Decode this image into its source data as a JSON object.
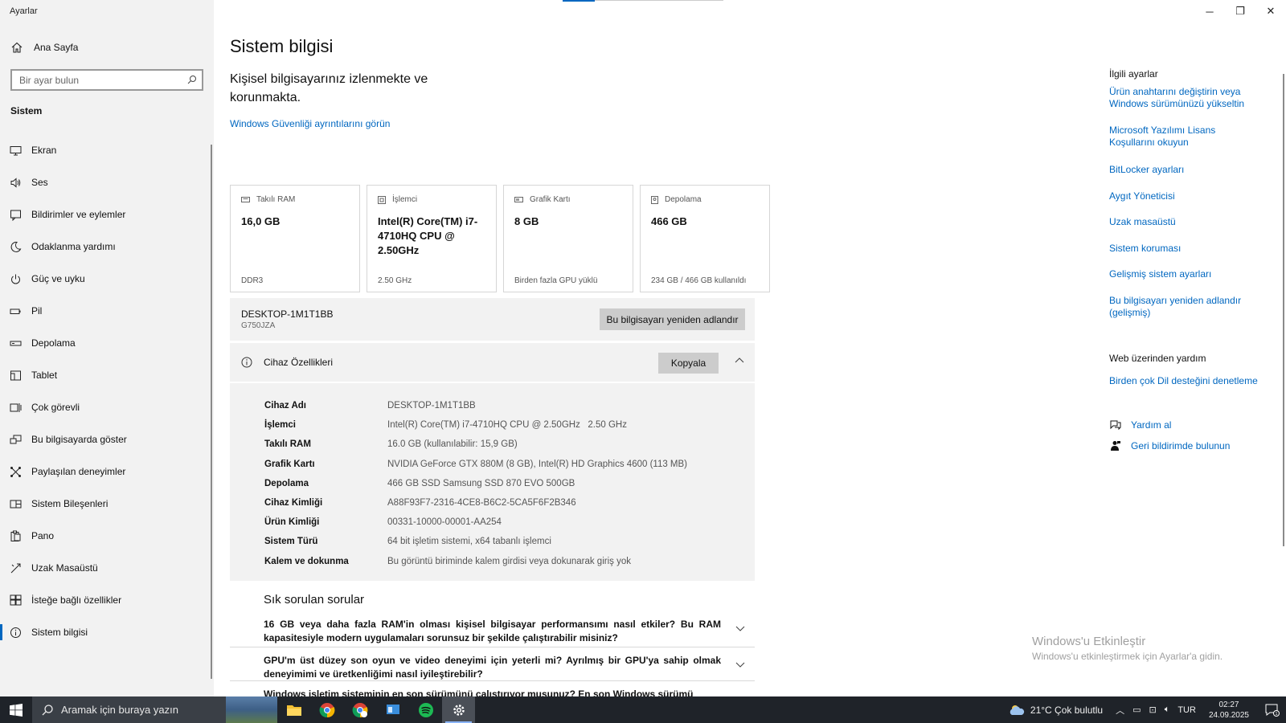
{
  "app": {
    "title": "Ayarlar"
  },
  "window": {
    "minimize": "─",
    "restore": "❐",
    "close": "✕"
  },
  "sidebar": {
    "home_label": "Ana Sayfa",
    "search_placeholder": "Bir ayar bulun",
    "section": "Sistem",
    "items": [
      {
        "label": "Ekran",
        "icon": "monitor-icon"
      },
      {
        "label": "Ses",
        "icon": "speaker-icon"
      },
      {
        "label": "Bildirimler ve eylemler",
        "icon": "notification-icon"
      },
      {
        "label": "Odaklanma yardımı",
        "icon": "moon-icon"
      },
      {
        "label": "Güç ve uyku",
        "icon": "power-icon"
      },
      {
        "label": "Pil",
        "icon": "battery-icon"
      },
      {
        "label": "Depolama",
        "icon": "storage-icon"
      },
      {
        "label": "Tablet",
        "icon": "tablet-icon"
      },
      {
        "label": "Çok görevli",
        "icon": "multitask-icon"
      },
      {
        "label": "Bu bilgisayarda göster",
        "icon": "project-icon"
      },
      {
        "label": "Paylaşılan deneyimler",
        "icon": "share-icon"
      },
      {
        "label": "Sistem Bileşenleri",
        "icon": "components-icon"
      },
      {
        "label": "Pano",
        "icon": "clipboard-icon"
      },
      {
        "label": "Uzak Masaüstü",
        "icon": "remote-icon"
      },
      {
        "label": "İsteğe bağlı özellikler",
        "icon": "features-icon"
      },
      {
        "label": "Sistem bilgisi",
        "icon": "info-icon",
        "active": true
      }
    ]
  },
  "main": {
    "title": "Sistem bilgisi",
    "protection_text": "Kişisel bilgisayarınız izlenmekte ve korunmakta.",
    "security_link": "Windows Güvenliği ayrıntılarını görün",
    "cards": [
      {
        "label": "Takılı RAM",
        "value": "16,0 GB",
        "sub": "DDR3"
      },
      {
        "label": "İşlemci",
        "value": "Intel(R) Core(TM) i7-4710HQ CPU @ 2.50GHz",
        "sub": "2.50 GHz"
      },
      {
        "label": "Grafik Kartı",
        "value": "8 GB",
        "sub": "Birden fazla GPU yüklü"
      },
      {
        "label": "Depolama",
        "value": "466 GB",
        "sub": "234 GB / 466 GB kullanıldı"
      }
    ],
    "device": {
      "name": "DESKTOP-1M1T1BB",
      "model": "G750JZA",
      "rename_button": "Bu bilgisayarı yeniden adlandır"
    },
    "specs": {
      "title": "Cihaz Özellikleri",
      "copy_button": "Kopyala",
      "rows": [
        {
          "key": "Cihaz Adı",
          "value": "DESKTOP-1M1T1BB"
        },
        {
          "key": "İşlemci",
          "value": "Intel(R) Core(TM) i7-4710HQ CPU @ 2.50GHz   2.50 GHz"
        },
        {
          "key": "Takılı RAM",
          "value": "16.0 GB (kullanılabilir: 15,9 GB)"
        },
        {
          "key": "Grafik Kartı",
          "value": "NVIDIA GeForce GTX 880M (8 GB), Intel(R) HD Graphics 4600 (113 MB)"
        },
        {
          "key": "Depolama",
          "value": "466 GB SSD Samsung SSD 870 EVO 500GB"
        },
        {
          "key": "Cihaz Kimliği",
          "value": "A88F93F7-2316-4CE8-B6C2-5CA5F6F2B346"
        },
        {
          "key": "Ürün Kimliği",
          "value": "00331-10000-00001-AA254"
        },
        {
          "key": "Sistem Türü",
          "value": "64 bit işletim sistemi, x64 tabanlı işlemci"
        },
        {
          "key": "Kalem ve dokunma",
          "value": "Bu görüntü biriminde kalem girdisi veya dokunarak giriş yok"
        }
      ]
    },
    "faq": {
      "title": "Sık sorulan sorular",
      "items": [
        "16 GB veya daha fazla RAM'in olması kişisel bilgisayar performansımı nasıl etkiler? Bu RAM kapasitesiyle modern uygulamaları sorunsuz bir şekilde çalıştırabilir misiniz?",
        "GPU'm üst düzey son oyun ve video deneyimi için yeterli mi? Ayrılmış bir GPU'ya sahip olmak deneyimimi ve üretkenliğimi nasıl iyileştirebilir?",
        "Windows işletim sisteminin en son sürümünü çalıştırıyor musunuz? En son Windows sürümü"
      ]
    }
  },
  "related": {
    "title": "İlgili ayarlar",
    "links": [
      "Ürün anahtarını değiştirin veya Windows sürümünüzü yükseltin",
      "Microsoft Yazılımı Lisans Koşullarını okuyun",
      "BitLocker ayarları",
      "Aygıt Yöneticisi",
      "Uzak masaüstü",
      "Sistem koruması",
      "Gelişmiş sistem ayarları",
      "Bu bilgisayarı yeniden adlandır (gelişmiş)"
    ],
    "web_title": "Web üzerinden yardım",
    "web_link": "Birden çok Dil desteğini denetleme",
    "help": "Yardım al",
    "feedback": "Geri bildirimde bulunun"
  },
  "watermark": {
    "title": "Windows'u Etkinleştir",
    "subtitle": "Windows'u etkinleştirmek için Ayarlar'a gidin."
  },
  "taskbar": {
    "search_placeholder": "Aramak için buraya yazın",
    "weather": "21°C  Çok bulutlu",
    "language": "TUR",
    "time": "02:27",
    "date": "24.09.2025",
    "notification_count": "1"
  }
}
